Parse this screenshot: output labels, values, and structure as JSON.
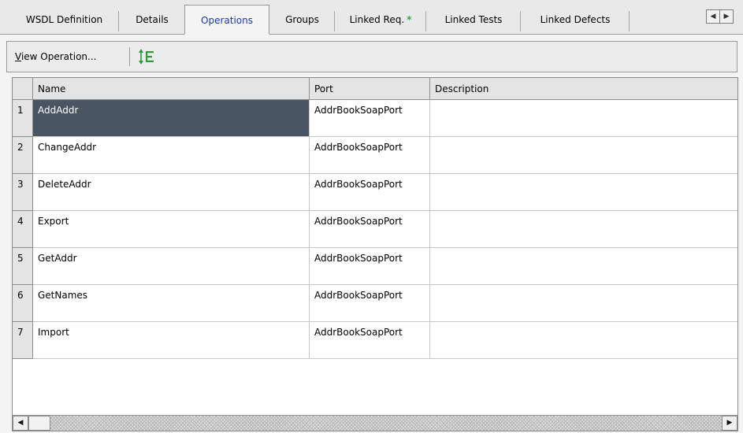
{
  "tabs": [
    {
      "label": "WSDL Definition"
    },
    {
      "label": "Details"
    },
    {
      "label": "Operations"
    },
    {
      "label": "Groups"
    },
    {
      "label": "Linked Req.",
      "badge": "*"
    },
    {
      "label": "Linked Tests"
    },
    {
      "label": "Linked Defects"
    }
  ],
  "active_tab": "Operations",
  "tab_nav": {
    "left_icon": "arrow-left-icon",
    "right_icon": "arrow-right-icon"
  },
  "toolbar": {
    "view_operation": {
      "mnemonic": "V",
      "rest": "iew Operation..."
    },
    "set_column_icon": "column-order-icon"
  },
  "table": {
    "columns": [
      "Name",
      "Port",
      "Description"
    ],
    "rows": [
      {
        "num": "1",
        "name": "AddAddr",
        "port": "AddrBookSoapPort",
        "description": ""
      },
      {
        "num": "2",
        "name": "ChangeAddr",
        "port": "AddrBookSoapPort",
        "description": ""
      },
      {
        "num": "3",
        "name": "DeleteAddr",
        "port": "AddrBookSoapPort",
        "description": ""
      },
      {
        "num": "4",
        "name": "Export",
        "port": "AddrBookSoapPort",
        "description": ""
      },
      {
        "num": "5",
        "name": "GetAddr",
        "port": "AddrBookSoapPort",
        "description": ""
      },
      {
        "num": "6",
        "name": "GetNames",
        "port": "AddrBookSoapPort",
        "description": ""
      },
      {
        "num": "7",
        "name": "Import",
        "port": "AddrBookSoapPort",
        "description": ""
      }
    ],
    "selected_row": "1"
  },
  "colors": {
    "active_tab_text": "#1c3aa8",
    "selected_cell": "#4a5563",
    "asterisk": "#39a845",
    "icon": "#2e9a3a"
  }
}
